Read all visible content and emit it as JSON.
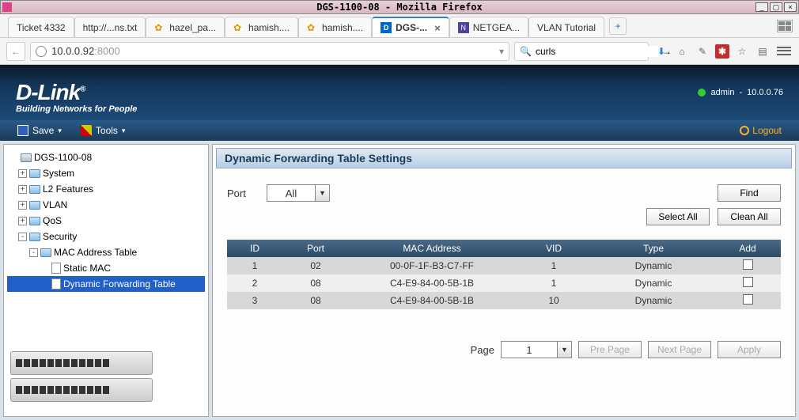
{
  "window": {
    "title": "DGS-1100-08 - Mozilla Firefox"
  },
  "tabs": [
    {
      "label": "Ticket 4332"
    },
    {
      "label": "http://...ns.txt"
    },
    {
      "label": "hazel_pa..."
    },
    {
      "label": "hamish...."
    },
    {
      "label": "hamish...."
    },
    {
      "label": "DGS-...",
      "active": true
    },
    {
      "label": "NETGEA..."
    },
    {
      "label": "VLAN Tutorial"
    }
  ],
  "url": {
    "host": "10.0.0.92",
    "port": ":8000"
  },
  "search": {
    "value": "curls"
  },
  "brand": {
    "logo": "D-Link",
    "tagline": "Building Networks for People"
  },
  "user": {
    "name": "admin",
    "ip": "10.0.0.76"
  },
  "menu": {
    "save": "Save",
    "tools": "Tools",
    "logout": "Logout"
  },
  "tree": {
    "root": "DGS-1100-08",
    "nodes": [
      "System",
      "L2 Features",
      "VLAN",
      "QoS",
      "Security"
    ],
    "security_child": "MAC Address Table",
    "mac_children": {
      "static": "Static MAC",
      "dynamic": "Dynamic Forwarding Table"
    }
  },
  "panel": {
    "title": "Dynamic Forwarding Table Settings",
    "port_label": "Port",
    "port_value": "All",
    "find": "Find",
    "select_all": "Select All",
    "clean_all": "Clean All",
    "cols": {
      "id": "ID",
      "port": "Port",
      "mac": "MAC Address",
      "vid": "VID",
      "type": "Type",
      "add": "Add"
    },
    "rows": [
      {
        "id": "1",
        "port": "02",
        "mac": "00-0F-1F-B3-C7-FF",
        "vid": "1",
        "type": "Dynamic"
      },
      {
        "id": "2",
        "port": "08",
        "mac": "C4-E9-84-00-5B-1B",
        "vid": "1",
        "type": "Dynamic"
      },
      {
        "id": "3",
        "port": "08",
        "mac": "C4-E9-84-00-5B-1B",
        "vid": "10",
        "type": "Dynamic"
      }
    ],
    "page_label": "Page",
    "page_value": "1",
    "pre": "Pre Page",
    "next": "Next Page",
    "apply": "Apply"
  }
}
